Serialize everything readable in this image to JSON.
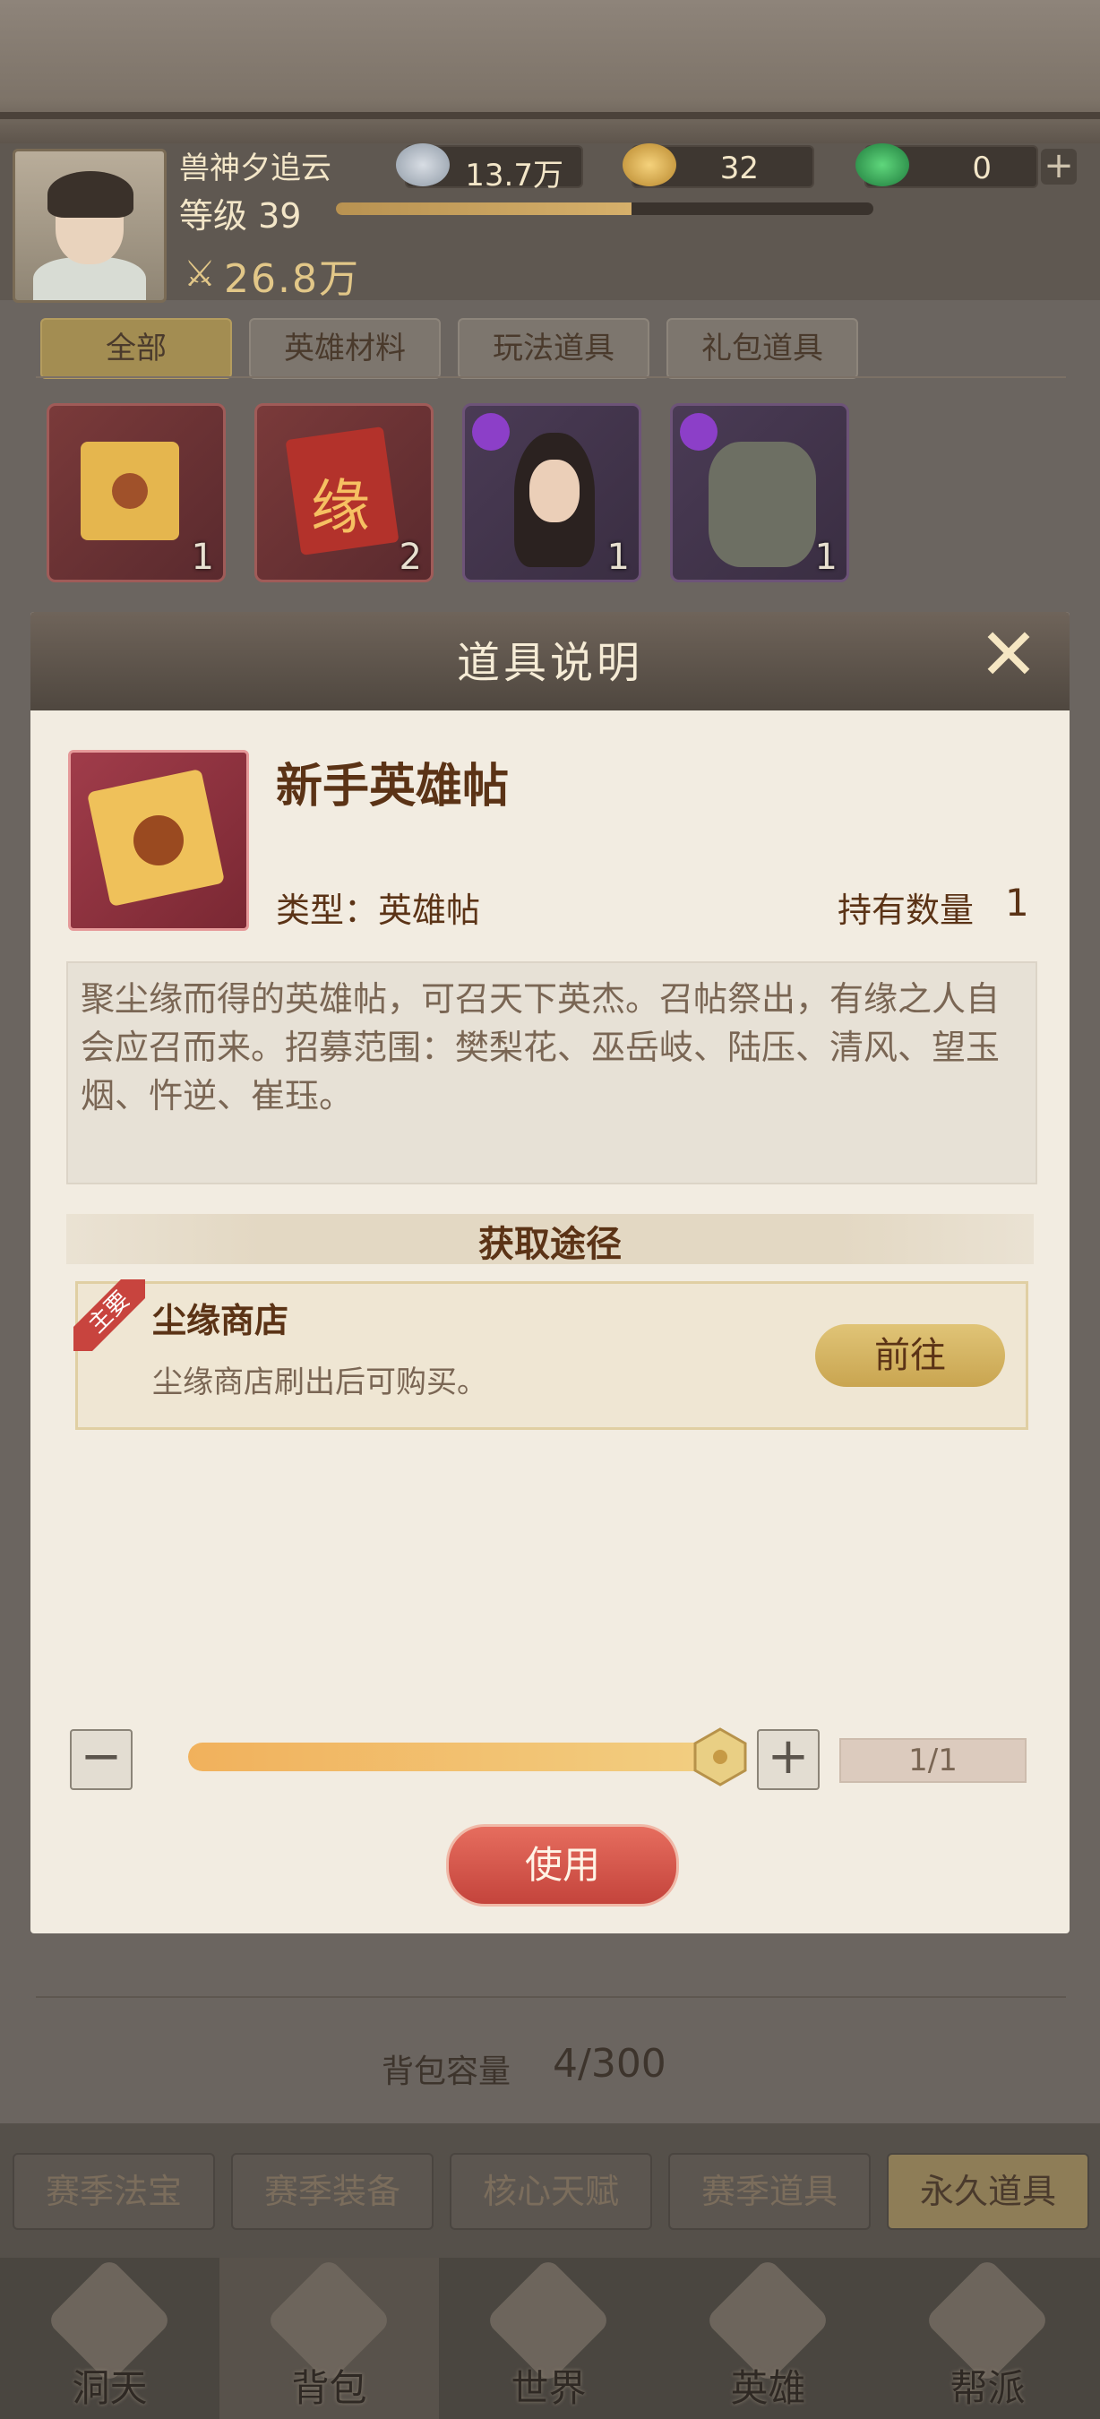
{
  "player": {
    "name": "兽神夕追云",
    "level_label": "等级 39",
    "exp_fraction": 0.55,
    "power": "26.8万"
  },
  "currencies": [
    {
      "icon": "silver-ingot-icon",
      "value": "13.7万"
    },
    {
      "icon": "gold-ingot-icon",
      "value": "32"
    },
    {
      "icon": "jade-icon",
      "value": "0"
    }
  ],
  "filter_tabs": [
    "全部",
    "英雄材料",
    "玩法道具",
    "礼包道具"
  ],
  "inventory": [
    {
      "name": "新手英雄帖",
      "count": "1"
    },
    {
      "name": "缘",
      "count": "2"
    },
    {
      "name": "hero-card-female",
      "count": "1"
    },
    {
      "name": "hero-card-golem",
      "count": "1"
    }
  ],
  "modal": {
    "title": "道具说明",
    "item_name": "新手英雄帖",
    "type_label": "类型：英雄帖",
    "hold_label": "持有数量",
    "hold_value": "1",
    "description": "聚尘缘而得的英雄帖，可召天下英杰。召帖祭出，有缘之人自会应召而来。招募范围：樊梨花、巫岳岐、陆压、清风、望玉烟、忤逆、崔珏。",
    "acquire_title": "获取途径",
    "source": {
      "ribbon": "主要",
      "name": "尘缘商店",
      "desc": "尘缘商店刷出后可购买。",
      "goto": "前往"
    },
    "quantity": "1/1",
    "slider_fraction": 1.0,
    "use": "使用"
  },
  "bag_capacity_label": "背包容量",
  "bag_capacity_value": "4/300",
  "categories": [
    "赛季法宝",
    "赛季装备",
    "核心天赋",
    "赛季道具",
    "永久道具"
  ],
  "nav": [
    {
      "label": "洞天",
      "icon": "pavilion-icon"
    },
    {
      "label": "背包",
      "icon": "bag-icon"
    },
    {
      "label": "世界",
      "icon": "scroll-icon"
    },
    {
      "label": "英雄",
      "icon": "hero-hat-icon"
    },
    {
      "label": "帮派",
      "icon": "banner-icon"
    }
  ]
}
